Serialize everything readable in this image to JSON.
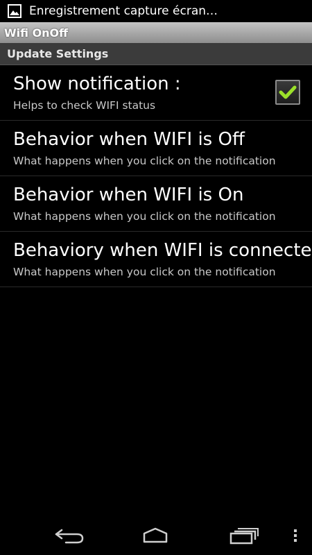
{
  "status_bar": {
    "notification_text": "Enregistrement capture écran…",
    "notification_icon": "image-icon"
  },
  "app_bar": {
    "title": "Wifi OnOff"
  },
  "category": {
    "title": "Update Settings"
  },
  "preferences": [
    {
      "title": "Show notification :",
      "summary": "Helps to check WIFI status",
      "checked": true
    },
    {
      "title": "Behavior when WIFI is Off",
      "summary": "What happens when you click on the notification"
    },
    {
      "title": "Behavior when WIFI is On",
      "summary": "What happens when you click on the notification"
    },
    {
      "title": "Behaviory when WIFI is connected",
      "summary": "What happens when you click on the notification"
    }
  ],
  "nav_bar": {
    "back_icon": "back-icon",
    "home_icon": "home-icon",
    "recents_icon": "recent-apps-icon",
    "menu_icon": "overflow-menu-icon"
  },
  "colors": {
    "checkmark": "#9be02a",
    "background": "#000000",
    "title_bar": "#a8a8a8",
    "category_bar": "#3b3b3b"
  }
}
